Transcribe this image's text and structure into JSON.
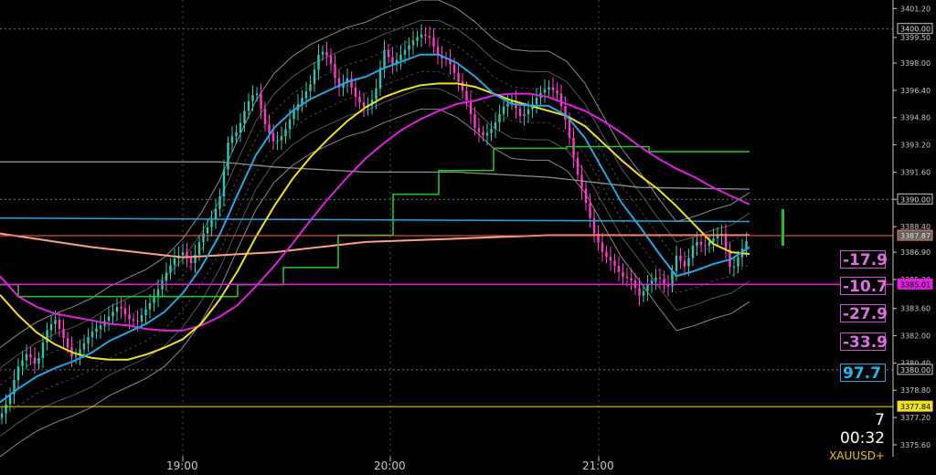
{
  "colors": {
    "background": "#000000",
    "axis": "#c8c8c8",
    "candle_up": "#2ec8b0",
    "candle_down": "#ff3cc8",
    "magenta": "#e020e0",
    "yellow": "#f0e020",
    "cyan": "#20a8e0",
    "green": "#20d020",
    "salmon": "#ffa080"
  },
  "indicators": [
    "-17.9",
    "-10.7",
    "-27.9",
    "-33.9",
    "97.7"
  ],
  "info": {
    "countdown_min": "7",
    "countdown_sec": "00:32",
    "symbol": "XAUUSD+"
  },
  "chart_data": {
    "type": "line",
    "symbol": "XAUUSD+",
    "y_axis_ticks": [
      "3401.20",
      "3399.50",
      "3398.00",
      "3396.40",
      "3394.80",
      "3393.20",
      "3391.60",
      "3390.00",
      "3388.40",
      "3386.90",
      "3385.30",
      "3383.60",
      "3382.00",
      "3380.40",
      "3378.80",
      "3377.20",
      "3375.60"
    ],
    "x_axis_ticks": [
      "19:00",
      "20:00",
      "21:00"
    ],
    "ylim": [
      3374.9,
      3401.7
    ],
    "price_labels": [
      {
        "text": "3400.00",
        "price": 3400.0,
        "color": "#c8c8c8"
      },
      {
        "text": "3390.00",
        "price": 3390.0,
        "color": "#c8c8c8"
      },
      {
        "text": "3387.87",
        "price": 3387.87,
        "color": "#ff8060"
      },
      {
        "text": "3385.01",
        "price": 3385.01,
        "color": "#e020e0"
      },
      {
        "text": "3380.00",
        "price": 3380.0,
        "color": "#c8c8c8"
      },
      {
        "text": "3377.84",
        "price": 3377.84,
        "color": "#f0e020"
      }
    ],
    "series": [
      {
        "role": "close",
        "x": [
          0,
          10,
          20,
          30,
          40,
          50,
          60,
          70,
          80,
          90,
          100,
          110,
          120,
          130,
          140,
          150,
          160,
          170,
          180,
          190,
          200,
          210,
          220,
          230,
          240,
          250,
          260,
          270,
          280,
          290,
          300,
          310,
          320,
          330,
          340,
          350,
          360,
          370,
          380,
          390,
          400,
          410,
          420,
          430,
          440,
          450,
          460,
          470,
          480,
          490,
          500,
          510,
          520,
          530,
          540,
          550,
          560,
          570,
          580,
          590,
          600,
          610,
          620,
          630,
          640,
          650,
          660,
          670,
          680,
          690,
          700,
          710,
          720,
          730,
          740,
          750,
          760,
          770,
          780,
          790,
          800,
          810,
          820
        ],
        "y": [
          3377.2,
          3378.4,
          3380.2,
          3381.0,
          3380.2,
          3382.2,
          3383.0,
          3381.8,
          3380.6,
          3381.4,
          3382.2,
          3382.6,
          3383.2,
          3383.8,
          3383.0,
          3382.8,
          3383.6,
          3384.4,
          3385.5,
          3386.5,
          3386.9,
          3386.2,
          3387.8,
          3388.6,
          3390.0,
          3393.5,
          3394.0,
          3395.6,
          3396.4,
          3394.4,
          3393.3,
          3393.8,
          3395.1,
          3395.9,
          3396.8,
          3398.8,
          3398.3,
          3396.5,
          3397.1,
          3395.9,
          3395.3,
          3396.1,
          3398.8,
          3397.9,
          3398.6,
          3399.2,
          3399.7,
          3399.5,
          3398.3,
          3398.2,
          3397.1,
          3395.9,
          3394.1,
          3393.7,
          3394.3,
          3395.4,
          3395.8,
          3394.8,
          3395.4,
          3396.2,
          3396.6,
          3396.2,
          3394.4,
          3391.8,
          3390.0,
          3388.0,
          3386.8,
          3386.3,
          3385.5,
          3385.3,
          3384.3,
          3385.1,
          3385.5,
          3384.7,
          3386.7,
          3386.0,
          3387.6,
          3387.2,
          3387.7,
          3388.0,
          3385.7,
          3386.9,
          3387.9
        ]
      },
      {
        "role": "ma-cyan",
        "x": [
          0,
          20,
          40,
          60,
          80,
          100,
          120,
          140,
          160,
          180,
          200,
          220,
          240,
          260,
          280,
          300,
          320,
          340,
          360,
          380,
          400,
          420,
          440,
          460,
          480,
          500,
          520,
          540,
          560,
          580,
          600,
          620,
          640,
          660,
          680,
          700,
          720,
          740,
          760,
          780,
          800,
          820
        ],
        "y": [
          3378.1,
          3378.9,
          3379.6,
          3380.1,
          3380.5,
          3381.0,
          3381.7,
          3382.2,
          3382.7,
          3383.4,
          3384.5,
          3386.0,
          3387.9,
          3390.3,
          3392.6,
          3394.2,
          3395.2,
          3395.9,
          3396.4,
          3396.9,
          3397.2,
          3397.7,
          3398.1,
          3398.5,
          3398.5,
          3398.0,
          3397.2,
          3396.2,
          3395.6,
          3395.5,
          3395.5,
          3394.9,
          3393.6,
          3391.7,
          3389.8,
          3388.4,
          3386.9,
          3385.5,
          3385.8,
          3386.2,
          3386.5,
          3387.2
        ]
      },
      {
        "role": "ma-yellow",
        "x": [
          0,
          20,
          40,
          60,
          80,
          100,
          120,
          140,
          160,
          180,
          200,
          220,
          240,
          260,
          280,
          300,
          320,
          340,
          360,
          380,
          400,
          420,
          440,
          460,
          480,
          500,
          520,
          540,
          560,
          580,
          600,
          620,
          640,
          660,
          680,
          700,
          720,
          740,
          760,
          780,
          800,
          820
        ],
        "y": [
          3384.4,
          3383.2,
          3382.2,
          3381.5,
          3381.0,
          3380.7,
          3380.6,
          3380.6,
          3380.9,
          3381.3,
          3381.8,
          3382.7,
          3384.1,
          3385.8,
          3387.8,
          3389.6,
          3391.2,
          3392.5,
          3393.6,
          3394.6,
          3395.4,
          3396.0,
          3396.4,
          3396.7,
          3396.8,
          3396.8,
          3396.6,
          3396.2,
          3395.8,
          3395.5,
          3395.2,
          3394.9,
          3394.3,
          3393.3,
          3392.3,
          3391.4,
          3390.6,
          3389.6,
          3388.5,
          3387.4,
          3386.9,
          3386.8
        ]
      },
      {
        "role": "ma-magenta",
        "x": [
          0,
          20,
          40,
          60,
          80,
          100,
          120,
          140,
          160,
          180,
          200,
          220,
          240,
          260,
          280,
          300,
          320,
          340,
          360,
          380,
          400,
          420,
          440,
          460,
          480,
          500,
          520,
          540,
          560,
          580,
          600,
          620,
          640,
          660,
          680,
          700,
          720,
          740,
          760,
          780,
          800,
          820
        ],
        "y": [
          3385.5,
          3384.3,
          3383.7,
          3383.3,
          3383.1,
          3382.9,
          3382.7,
          3382.6,
          3382.4,
          3382.3,
          3382.3,
          3382.6,
          3383.1,
          3383.8,
          3384.9,
          3386.1,
          3387.4,
          3388.8,
          3390.1,
          3391.3,
          3392.4,
          3393.3,
          3394.1,
          3394.7,
          3395.2,
          3395.6,
          3395.8,
          3396.1,
          3396.2,
          3396.2,
          3396.0,
          3395.6,
          3395.2,
          3394.6,
          3393.9,
          3393.1,
          3392.4,
          3391.8,
          3391.3,
          3390.7,
          3390.2,
          3389.7
        ]
      },
      {
        "role": "ma-salmon",
        "x": [
          0,
          100,
          200,
          300,
          400,
          500,
          600,
          700,
          800,
          820
        ],
        "y": [
          3388.0,
          3387.2,
          3386.6,
          3386.9,
          3387.5,
          3387.7,
          3387.9,
          3387.9,
          3387.9,
          3387.9
        ]
      },
      {
        "role": "level-cyan",
        "x": [
          0,
          820
        ],
        "y": [
          3388.9,
          3388.7
        ]
      },
      {
        "role": "level-grey",
        "x": [
          0,
          240,
          300,
          400,
          500,
          600,
          700,
          820
        ],
        "y": [
          3392.2,
          3392.2,
          3391.9,
          3391.6,
          3391.6,
          3391.3,
          3390.7,
          3390.6
        ]
      },
      {
        "role": "green-steps",
        "x": [
          0,
          20,
          260,
          310,
          370,
          430,
          480,
          540,
          620,
          710,
          820
        ],
        "y": [
          3385.0,
          3384.3,
          3385.0,
          3386.0,
          3387.9,
          3390.3,
          3391.7,
          3393.0,
          3393.1,
          3392.8,
          3392.8
        ]
      }
    ]
  }
}
